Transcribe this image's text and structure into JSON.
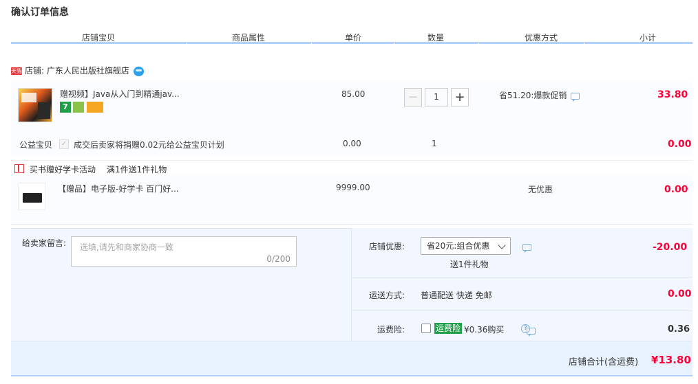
{
  "page": {
    "title": "确认订单信息"
  },
  "columns": [
    "店铺宝贝",
    "商品属性",
    "单价",
    "数量",
    "优惠方式",
    "小计"
  ],
  "shop": {
    "badge": "天猫",
    "label": "店铺: 广东人民出版社旗舰店"
  },
  "item": {
    "title": "赠视频】Java从入门到精通jav...",
    "badge_seven": "7",
    "unit_price": "85.00",
    "quantity": "1",
    "qty_minus": "−",
    "qty_plus": "+",
    "promo": "省51.20:爆款促销",
    "subtotal": "33.80"
  },
  "charity": {
    "label": "公益宝贝",
    "check": "✓",
    "text": "成交后卖家将捐赠0.02元给公益宝贝计划",
    "price": "0.00",
    "quantity": "1",
    "subtotal": "0.00"
  },
  "gift_activity": {
    "title": "买书赠好学卡活动",
    "condition": "满1件送1件礼物"
  },
  "gift": {
    "title": "【赠品】电子版-好学卡 百门好...",
    "price": "9999.00",
    "promo": "无优惠",
    "subtotal": "0.00"
  },
  "message": {
    "label": "给卖家留言:",
    "placeholder": "选填,请先和商家协商一致",
    "count": "0/200"
  },
  "shop_discount": {
    "label": "店铺优惠:",
    "selected": "省20元:组合优惠",
    "note": "送1件礼物",
    "amount": "-20.00"
  },
  "shipping": {
    "label": "运送方式:",
    "method": "普通配送 快递 免邮",
    "amount": "0.00"
  },
  "freight_insurance": {
    "label": "运费险:",
    "tag": "运费险",
    "price_text": "¥0.36购买",
    "help": "?",
    "amount": "0.36"
  },
  "total": {
    "label": "店铺合计(含运费)",
    "amount": "¥13.80"
  },
  "colors": {
    "accent_red": "#ff0036",
    "header_line": "#b2d1ff",
    "panel_bg": "#f2f7ff",
    "insurance_green": "#21a04a"
  },
  "icons": [
    "tmall-badge",
    "wangwang-icon",
    "chat-icon",
    "gift-icon",
    "help-icon",
    "chevron-down-icon"
  ]
}
